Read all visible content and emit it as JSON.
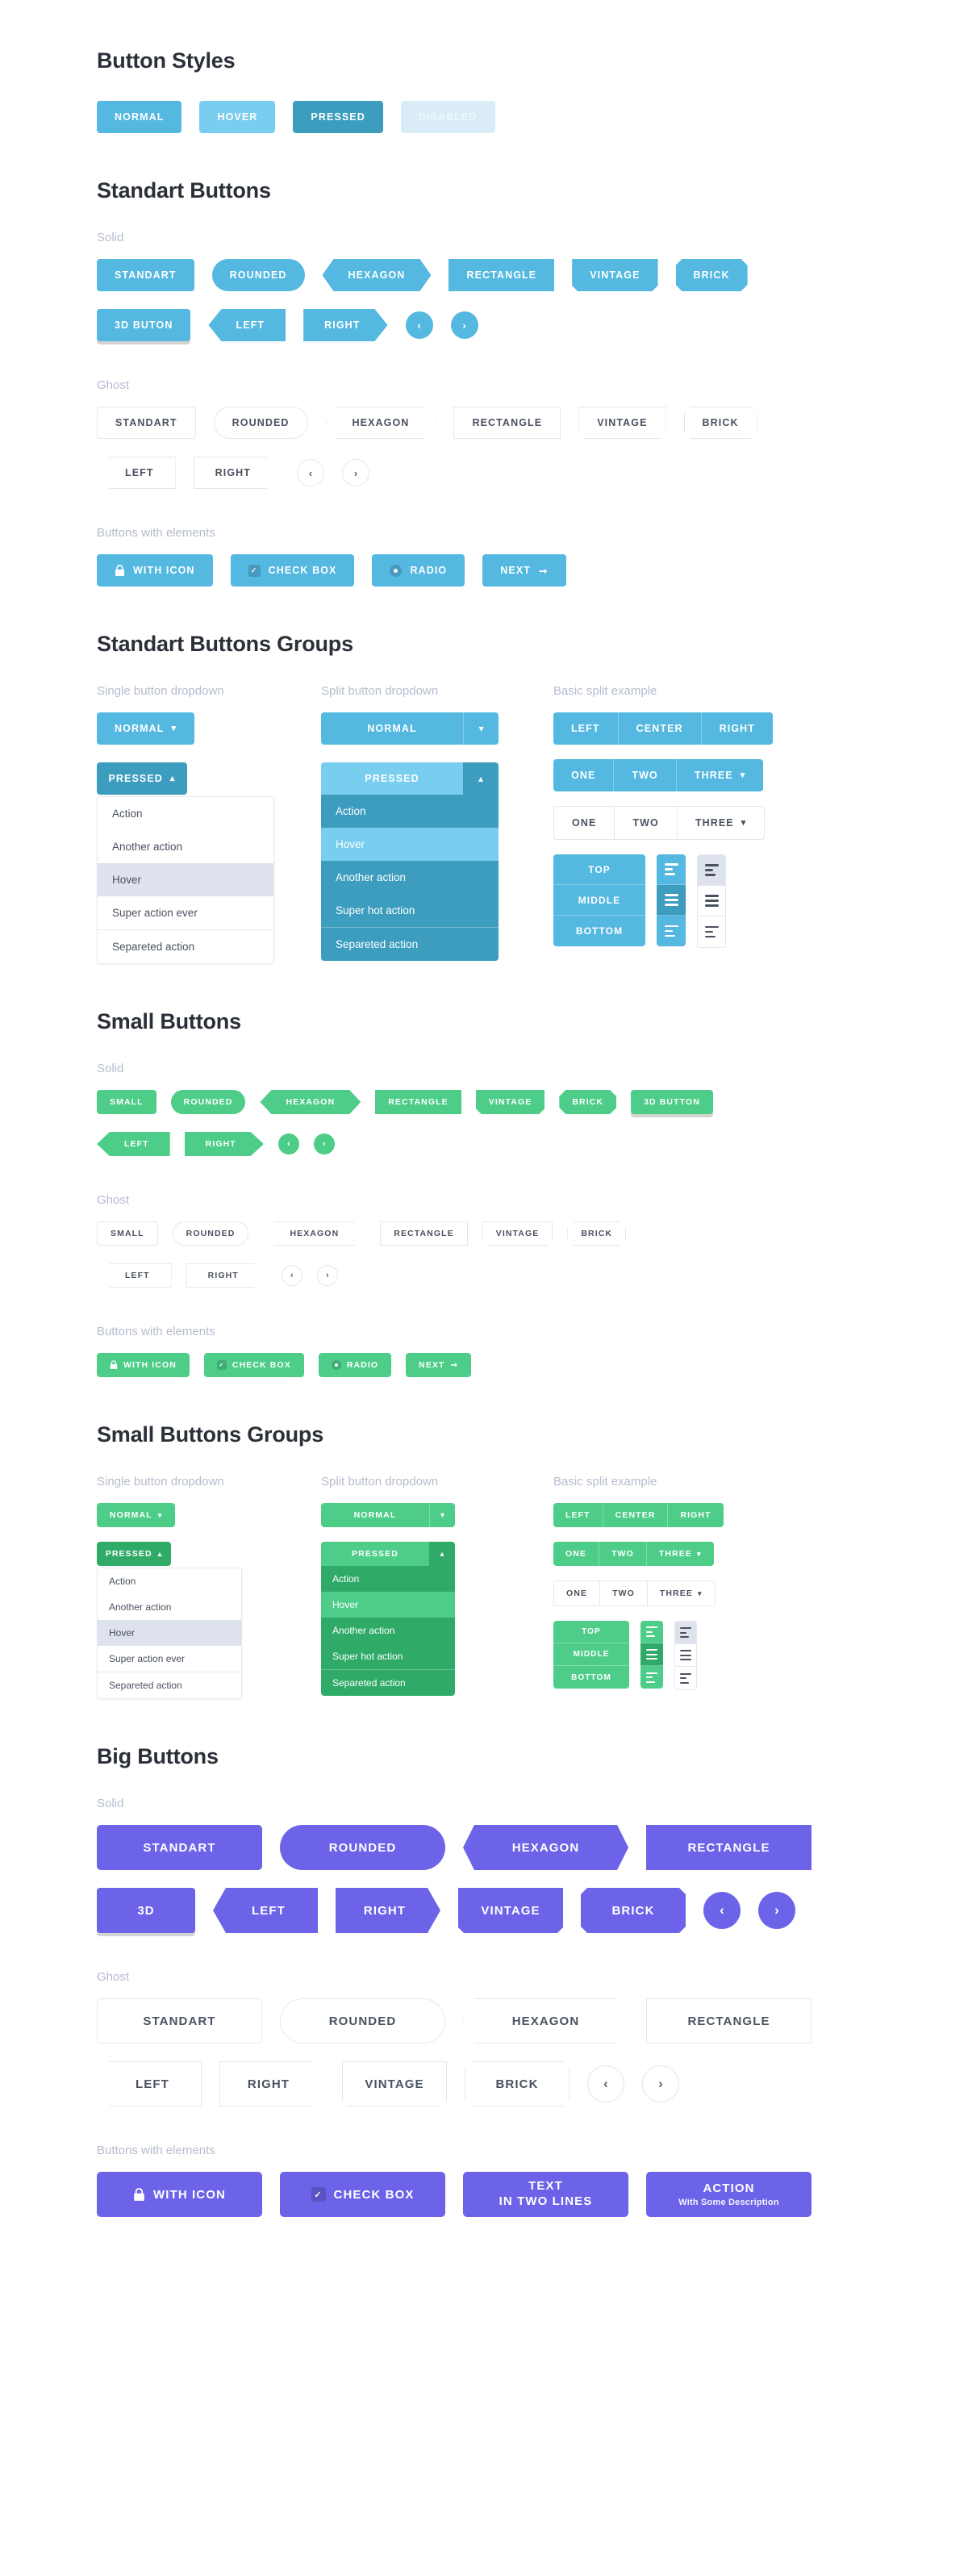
{
  "colors": {
    "blue": "#54b8e0",
    "blue_hover": "#79cdef",
    "blue_pressed": "#3c9dbf",
    "blue_disabled": "#daecf7",
    "green": "#4ecd89",
    "green_pressed": "#30ab67",
    "purple": "#6c63e8",
    "ghost_border": "#e2e7ef",
    "muted_text": "#b6bcce"
  },
  "sections": {
    "button_styles": {
      "title": "Button Styles",
      "states": [
        {
          "label": "NORMAL",
          "state": "normal"
        },
        {
          "label": "HOVER",
          "state": "hover"
        },
        {
          "label": "PRESSED",
          "state": "pressed"
        },
        {
          "label": "DISABLED",
          "state": "disabled"
        }
      ]
    },
    "standart_buttons": {
      "title": "Standart Buttons",
      "solid_label": "Solid",
      "ghost_label": "Ghost",
      "elements_label": "Buttons with elements",
      "solid_row1": [
        "STANDART",
        "ROUNDED",
        "HEXAGON",
        "RECTANGLE",
        "VINTAGE",
        "BRICK"
      ],
      "solid_row2": [
        "3D BUTON",
        "LEFT",
        "RIGHT"
      ],
      "ghost_row1": [
        "STANDART",
        "ROUNDED",
        "HEXAGON",
        "RECTANGLE",
        "VINTAGE",
        "BRICK"
      ],
      "ghost_row2": [
        "LEFT",
        "RIGHT"
      ],
      "nav_prev": "‹",
      "nav_next": "›",
      "elements": [
        {
          "label": "WITH ICON",
          "icon": "lock-icon"
        },
        {
          "label": "CHECK BOX",
          "icon": "checkbox-icon"
        },
        {
          "label": "RADIO",
          "icon": "radio-icon"
        },
        {
          "label": "NEXT",
          "icon": "arrow-right-icon"
        }
      ]
    },
    "standart_groups": {
      "title": "Standart Buttons Groups",
      "single_label": "Single button dropdown",
      "split_label": "Split button dropdown",
      "basic_label": "Basic split example",
      "single": {
        "normal": "NORMAL",
        "pressed": "PRESSED",
        "items": [
          "Action",
          "Another action",
          "Hover",
          "Super action ever",
          "Separeted action"
        ],
        "hover_index": 2,
        "separated_index": 4
      },
      "split": {
        "normal": "NORMAL",
        "pressed": "PRESSED",
        "items": [
          "Action",
          "Hover",
          "Another action",
          "Super hot action",
          "Separeted action"
        ],
        "hover_index": 1,
        "separated_index": 4
      },
      "basic": {
        "lcr": [
          "LEFT",
          "CENTER",
          "RIGHT"
        ],
        "solid_123": [
          "ONE",
          "TWO",
          "THREE"
        ],
        "ghost_123": [
          "ONE",
          "TWO",
          "THREE"
        ],
        "vertical": [
          "TOP",
          "MIDDLE",
          "BOTTOM"
        ],
        "align_icons": [
          "align-left-icon",
          "align-justify-icon",
          "align-left-icon"
        ]
      }
    },
    "small_buttons": {
      "title": "Small Buttons",
      "solid_label": "Solid",
      "ghost_label": "Ghost",
      "elements_label": "Buttons with elements",
      "solid_row1": [
        "SMALL",
        "ROUNDED",
        "HEXAGON",
        "RECTANGLE",
        "VINTAGE",
        "BRICK",
        "3D BUTTON"
      ],
      "solid_row2": [
        "LEFT",
        "RIGHT"
      ],
      "ghost_row1": [
        "SMALL",
        "ROUNDED",
        "HEXAGON",
        "RECTANGLE",
        "VINTAGE",
        "BRICK"
      ],
      "ghost_row2": [
        "LEFT",
        "RIGHT"
      ],
      "nav_prev": "‹",
      "nav_next": "›",
      "elements": [
        {
          "label": "WITH ICON",
          "icon": "lock-icon"
        },
        {
          "label": "CHECK BOX",
          "icon": "checkbox-icon"
        },
        {
          "label": "RADIO",
          "icon": "radio-icon"
        },
        {
          "label": "NEXT",
          "icon": "arrow-right-icon"
        }
      ]
    },
    "small_groups": {
      "title": "Small Buttons Groups",
      "single_label": "Single button dropdown",
      "split_label": "Split button dropdown",
      "basic_label": "Basic split example",
      "single": {
        "normal": "NORMAL",
        "pressed": "PRESSED",
        "items": [
          "Action",
          "Another action",
          "Hover",
          "Super action ever",
          "Separeted action"
        ],
        "hover_index": 2,
        "separated_index": 4
      },
      "split": {
        "normal": "NORMAL",
        "pressed": "PRESSED",
        "items": [
          "Action",
          "Hover",
          "Another action",
          "Super hot action",
          "Separeted action"
        ],
        "hover_index": 1,
        "separated_index": 4
      },
      "basic": {
        "lcr": [
          "LEFT",
          "CENTER",
          "RIGHT"
        ],
        "solid_123": [
          "ONE",
          "TWO",
          "THREE"
        ],
        "ghost_123": [
          "ONE",
          "TWO",
          "THREE"
        ],
        "vertical": [
          "TOP",
          "MIDDLE",
          "BOTTOM"
        ],
        "align_icons": [
          "align-left-icon",
          "align-justify-icon",
          "align-left-icon"
        ]
      }
    },
    "big_buttons": {
      "title": "Big Buttons",
      "solid_label": "Solid",
      "ghost_label": "Ghost",
      "elements_label": "Buttons with elements",
      "solid_row1": [
        "STANDART",
        "ROUNDED",
        "HEXAGON",
        "RECTANGLE"
      ],
      "solid_row2": [
        "3D",
        "LEFT",
        "RIGHT",
        "VINTAGE",
        "BRICK"
      ],
      "ghost_row1": [
        "STANDART",
        "ROUNDED",
        "HEXAGON",
        "RECTANGLE"
      ],
      "ghost_row2": [
        "LEFT",
        "RIGHT",
        "VINTAGE",
        "BRICK"
      ],
      "nav_prev": "‹",
      "nav_next": "›",
      "elements": [
        {
          "label": "WITH ICON",
          "icon": "lock-icon"
        },
        {
          "label": "CHECK BOX",
          "icon": "checkbox-icon"
        }
      ],
      "two_line": {
        "line1": "TEXT",
        "line2": "IN TWO LINES"
      },
      "action": {
        "title": "ACTION",
        "subtitle": "With Some Description"
      }
    }
  }
}
